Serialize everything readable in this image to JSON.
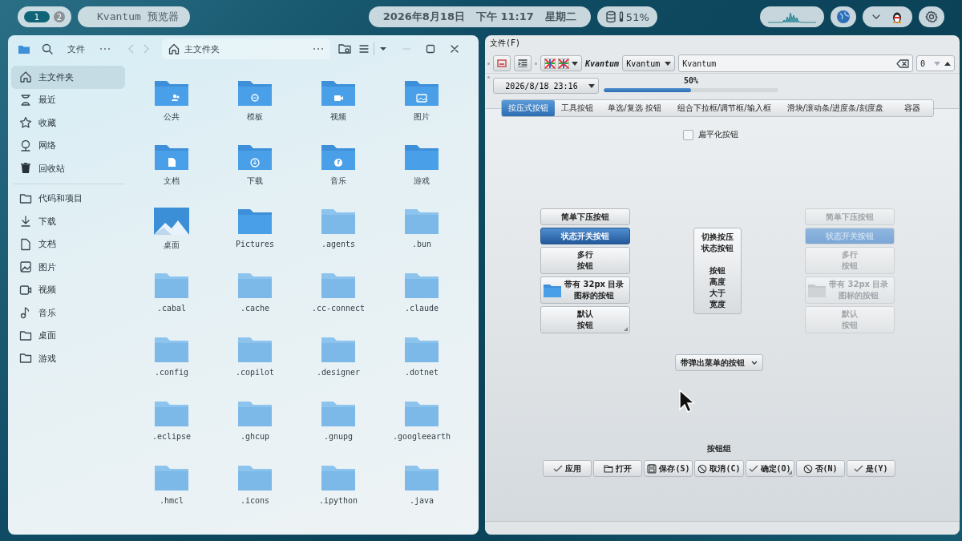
{
  "top_bar": {
    "workspaces": [
      {
        "label": "1",
        "selected": true
      },
      {
        "label": "2",
        "selected": false
      }
    ],
    "app_title": "Kvantum 预览器",
    "date": "2026年8月18日",
    "time": "下午 11:17",
    "weekday": "星期二",
    "battery": "51%"
  },
  "file_manager": {
    "menu": "文件",
    "path": "主文件夹",
    "places": [
      {
        "label": "主文件夹",
        "kind": "home",
        "selected": true
      },
      {
        "label": "最近",
        "kind": "recent",
        "selected": false
      },
      {
        "label": "收藏",
        "kind": "star",
        "selected": false
      },
      {
        "label": "网络",
        "kind": "network",
        "selected": false
      },
      {
        "label": "回收站",
        "kind": "trash",
        "selected": false
      }
    ],
    "bookmarks": [
      {
        "label": "代码和项目",
        "kind": "folder",
        "selected": false
      },
      {
        "label": "下载",
        "kind": "download",
        "selected": false
      },
      {
        "label": "文档",
        "kind": "document",
        "selected": false
      },
      {
        "label": "图片",
        "kind": "image",
        "selected": false
      },
      {
        "label": "视频",
        "kind": "video",
        "selected": false
      },
      {
        "label": "音乐",
        "kind": "music",
        "selected": false
      },
      {
        "label": "桌面",
        "kind": "folder",
        "selected": false
      },
      {
        "label": "游戏",
        "kind": "folder",
        "selected": false
      }
    ],
    "files": [
      {
        "name": "公共",
        "kind": "public",
        "hidden": false
      },
      {
        "name": "模板",
        "kind": "templates",
        "hidden": false
      },
      {
        "name": "视频",
        "kind": "video",
        "hidden": false
      },
      {
        "name": "图片",
        "kind": "pictures",
        "hidden": false
      },
      {
        "name": "文档",
        "kind": "documents",
        "hidden": false
      },
      {
        "name": "下载",
        "kind": "downloads",
        "hidden": false
      },
      {
        "name": "音乐",
        "kind": "music",
        "hidden": false
      },
      {
        "name": "游戏",
        "kind": "folder",
        "hidden": false
      },
      {
        "name": "桌面",
        "kind": "desktop",
        "hidden": false
      },
      {
        "name": "Pictures",
        "kind": "folder",
        "hidden": false
      },
      {
        "name": ".agents",
        "kind": "folder",
        "hidden": true
      },
      {
        "name": ".bun",
        "kind": "folder",
        "hidden": true
      },
      {
        "name": ".cabal",
        "kind": "folder",
        "hidden": true
      },
      {
        "name": ".cache",
        "kind": "folder",
        "hidden": true
      },
      {
        "name": ".cc-connect",
        "kind": "folder",
        "hidden": true
      },
      {
        "name": ".claude",
        "kind": "folder",
        "hidden": true
      },
      {
        "name": ".config",
        "kind": "folder",
        "hidden": true
      },
      {
        "name": ".copilot",
        "kind": "folder",
        "hidden": true
      },
      {
        "name": ".designer",
        "kind": "folder",
        "hidden": true
      },
      {
        "name": ".dotnet",
        "kind": "folder",
        "hidden": true
      },
      {
        "name": ".eclipse",
        "kind": "folder",
        "hidden": true
      },
      {
        "name": ".ghcup",
        "kind": "folder",
        "hidden": true
      },
      {
        "name": ".gnupg",
        "kind": "folder",
        "hidden": true
      },
      {
        "name": ".googleearth",
        "kind": "folder",
        "hidden": true
      },
      {
        "name": ".hmcl",
        "kind": "folder",
        "hidden": true
      },
      {
        "name": ".icons",
        "kind": "folder",
        "hidden": true
      },
      {
        "name": ".ipython",
        "kind": "folder",
        "hidden": true
      },
      {
        "name": ".java",
        "kind": "folder",
        "hidden": true
      }
    ]
  },
  "preview": {
    "menu": "文件(F)",
    "style_label": "Kvantum",
    "combo": "Kvantum",
    "line_edit": "Kvantum",
    "spin": "0",
    "date_time": "2026/8/18 23:16",
    "progress": {
      "text": "50%",
      "level": 0.5
    },
    "tabs": [
      {
        "label": "按压式按钮",
        "selected": true
      },
      {
        "label": "工具按钮",
        "selected": false
      },
      {
        "label": "单选/复选 按钮",
        "selected": false
      },
      {
        "label": "组合下拉框/调节框/输入框",
        "selected": false
      },
      {
        "label": "滑块/滚动条/进度条/刻度盘",
        "selected": false
      },
      {
        "label": "容器",
        "selected": false
      }
    ],
    "flat_checkbox": {
      "label": "扁平化按钮",
      "checked": false
    },
    "left_buttons": [
      {
        "lines": [
          "简单下压按钮"
        ],
        "kind": "push",
        "checked": false,
        "disabled": false
      },
      {
        "lines": [
          "状态开关按钮"
        ],
        "kind": "push",
        "checked": true,
        "disabled": false
      },
      {
        "lines": [
          "多行",
          "按钮"
        ],
        "kind": "push",
        "checked": false,
        "disabled": false
      },
      {
        "lines": [
          "带有 32px 目录",
          "图标的按钮"
        ],
        "kind": "icon",
        "checked": false,
        "disabled": false
      },
      {
        "lines": [
          "默认",
          "按钮"
        ],
        "kind": "default",
        "checked": false,
        "disabled": false
      }
    ],
    "center_button": {
      "line_groups": [
        [
          "切换按压",
          "状态按钮"
        ],
        [
          "按钮",
          "高度",
          "大于",
          "宽度"
        ]
      ],
      "checked": false
    },
    "right_buttons": [
      {
        "lines": [
          "简单下压按钮"
        ],
        "kind": "push",
        "checked": false,
        "disabled": true
      },
      {
        "lines": [
          "状态开关按钮"
        ],
        "kind": "push",
        "checked": true,
        "disabled": true
      },
      {
        "lines": [
          "多行",
          "按钮"
        ],
        "kind": "push",
        "checked": false,
        "disabled": true
      },
      {
        "lines": [
          "带有 32px 目录",
          "图标的按钮"
        ],
        "kind": "icon",
        "checked": false,
        "disabled": true
      },
      {
        "lines": [
          "默认",
          "按钮"
        ],
        "kind": "push",
        "checked": false,
        "disabled": true
      }
    ],
    "popup_button": "带弹出菜单的按钮",
    "group_label": "按钮组",
    "dialog_buttons": [
      {
        "label": "应用",
        "kind": "check",
        "default": false
      },
      {
        "label": "打开",
        "kind": "open",
        "default": false
      },
      {
        "label": "保存(S)",
        "kind": "save",
        "default": false
      },
      {
        "label": "取消(C)",
        "kind": "cancel",
        "default": false
      },
      {
        "label": "确定(O)",
        "kind": "check",
        "default": true
      },
      {
        "label": "否(N)",
        "kind": "cancel",
        "default": false
      },
      {
        "label": "是(Y)",
        "kind": "check",
        "default": false
      }
    ]
  }
}
